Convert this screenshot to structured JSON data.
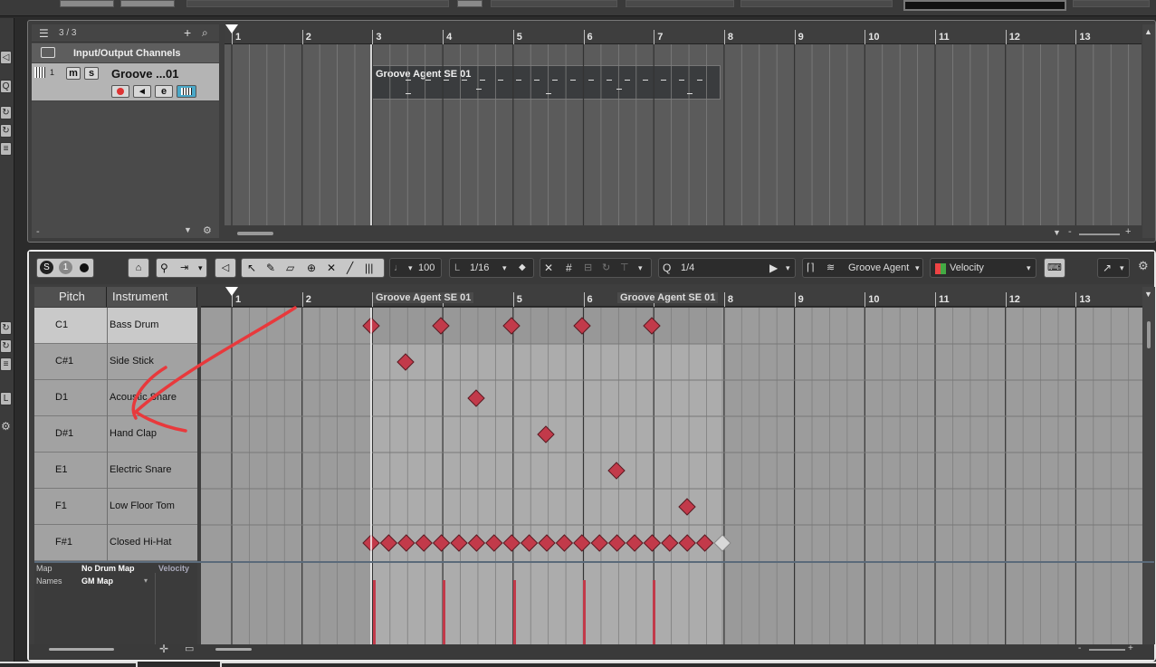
{
  "project": {
    "track_count": "3 / 3",
    "folder_track": "Input/Output Channels",
    "track_number": "1",
    "track_name": "Groove ...01",
    "mute_label": "m",
    "solo_label": "s",
    "edit_label": "e",
    "part_name": "Groove Agent SE 01",
    "ruler": [
      "1",
      "2",
      "3",
      "4",
      "5",
      "6",
      "7",
      "8",
      "9",
      "10",
      "11",
      "12",
      "13"
    ]
  },
  "editor": {
    "quantize": "1/16",
    "velocity_value": "100",
    "length_quantize": "1/4",
    "instrument_select": "Groove Agent",
    "lane_param": "Velocity",
    "columns": {
      "pitch": "Pitch",
      "instrument": "Instrument"
    },
    "ruler": [
      "1",
      "2",
      "3",
      "4",
      "5",
      "6",
      "7",
      "8",
      "9",
      "10",
      "11",
      "12",
      "13"
    ],
    "part_labels": [
      "Groove Agent SE 01",
      "Groove Agent SE 01"
    ],
    "rows": [
      {
        "pitch": "C1",
        "instrument": "Bass Drum"
      },
      {
        "pitch": "C#1",
        "instrument": "Side Stick"
      },
      {
        "pitch": "D1",
        "instrument": "Acoustic Snare"
      },
      {
        "pitch": "D#1",
        "instrument": "Hand Clap"
      },
      {
        "pitch": "E1",
        "instrument": "Electric Snare"
      },
      {
        "pitch": "F1",
        "instrument": "Low Floor Tom"
      },
      {
        "pitch": "F#1",
        "instrument": "Closed Hi-Hat"
      }
    ],
    "map_label": "Map",
    "map_value": "No Drum Map",
    "names_label": "Names",
    "names_value": "GM Map",
    "lane_tab": "Velocity"
  },
  "colors": {
    "note": "#c23a4a",
    "annotation": "#e8393c",
    "velocity": "#c23a4a"
  }
}
